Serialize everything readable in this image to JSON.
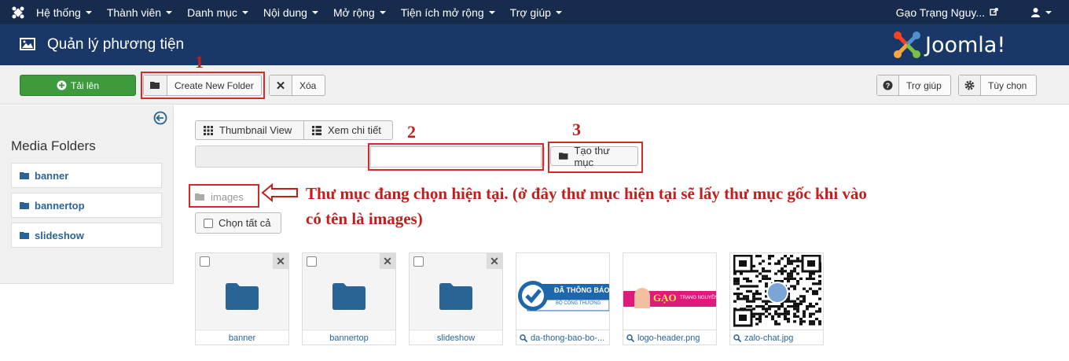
{
  "topbar": {
    "menu": [
      "Hệ thống",
      "Thành viên",
      "Danh mục",
      "Nội dung",
      "Mở rộng",
      "Tiện ích mở rộng",
      "Trợ giúp"
    ],
    "user": "Gạo Trạng Nguy..."
  },
  "header": {
    "title": "Quản lý phương tiện",
    "brand": "Joomla!"
  },
  "toolbar": {
    "upload": "Tải lên",
    "create_folder": "Create New Folder",
    "delete": "Xóa",
    "help": "Trợ giúp",
    "options": "Tùy chọn"
  },
  "sidebar": {
    "title": "Media Folders",
    "folders": [
      "banner",
      "bannertop",
      "slideshow"
    ]
  },
  "main": {
    "thumbnail_view": "Thumbnail View",
    "detail_view": "Xem chi tiết",
    "new_folder_value": "",
    "create_btn": "Tạo thư mục",
    "breadcrumb": "images",
    "select_all": "Chọn tất cả",
    "items": [
      {
        "name": "banner",
        "kind": "folder"
      },
      {
        "name": "bannertop",
        "kind": "folder"
      },
      {
        "name": "slideshow",
        "kind": "folder"
      },
      {
        "name": "da-thong-bao-bo-...",
        "kind": "image"
      },
      {
        "name": "logo-header.png",
        "kind": "image"
      },
      {
        "name": "zalo-chat.jpg",
        "kind": "image"
      }
    ],
    "thumb_text": {
      "da_thong_bao": "ĐÃ THÔNG BÁO",
      "bo_cong_thuong": "BỘ CÔNG THƯƠNG",
      "gao": "GẠO",
      "trang_nguyen": "TRẠNG NGUYÊN"
    }
  },
  "annotations": {
    "n1": "1",
    "n2": "2",
    "n3": "3",
    "note_line1": "Thư mục đang chọn hiện tại. (ở đây thư mục hiện tại sẽ lấy thư mục gốc khi vào",
    "note_line2": "có tên là images)"
  },
  "colors": {
    "topbar": "#172b4d",
    "header": "#1a3867",
    "upload": "#3d9b3d",
    "annotation": "#c0201d",
    "folder": "#2a6496"
  }
}
